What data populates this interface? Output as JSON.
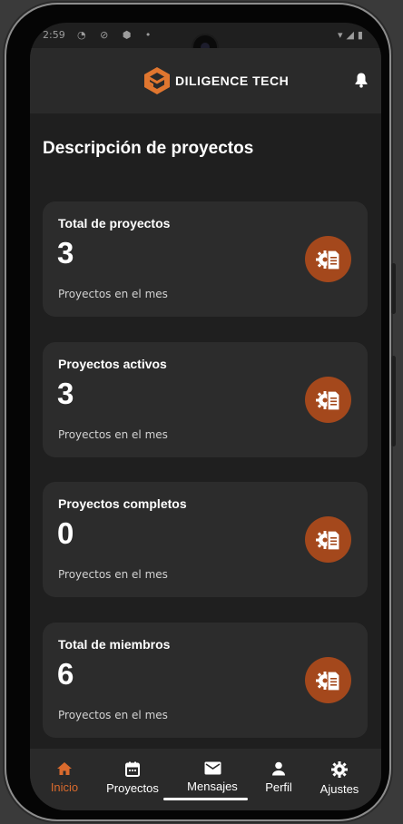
{
  "status": {
    "time": "2:59",
    "left_icons": "◔ ⊘ ⬢ •",
    "right_icons": "▾◢▮"
  },
  "header": {
    "brand": "DILIGENCE TECH",
    "brand_color": "#e0762f",
    "icons": [
      "logo-icon",
      "bell-icon"
    ]
  },
  "page": {
    "title": "Descripción de proyectos"
  },
  "cards": [
    {
      "title": "Total de proyectos",
      "value": "3",
      "subtitle": "Proyectos en el mes",
      "icon": "project-settings-icon"
    },
    {
      "title": "Proyectos activos",
      "value": "3",
      "subtitle": "Proyectos en el mes",
      "icon": "project-settings-icon"
    },
    {
      "title": "Proyectos completos",
      "value": "0",
      "subtitle": "Proyectos en el mes",
      "icon": "project-settings-icon"
    },
    {
      "title": "Total de miembros",
      "value": "6",
      "subtitle": "Proyectos en el mes",
      "icon": "project-settings-icon"
    }
  ],
  "nav": {
    "items": [
      {
        "label": "Inicio",
        "icon": "home-icon",
        "active": true
      },
      {
        "label": "Proyectos",
        "icon": "calendar-icon",
        "active": false
      },
      {
        "label": "Mensajes",
        "icon": "mail-icon",
        "active": false
      },
      {
        "label": "Perfil",
        "icon": "person-icon",
        "active": false
      },
      {
        "label": "Ajustes",
        "icon": "gear-icon",
        "active": false
      }
    ],
    "active_color": "#d96a2d"
  },
  "colors": {
    "background": "#1f1f1f",
    "card": "#2c2c2c",
    "accent": "#a4481c"
  }
}
